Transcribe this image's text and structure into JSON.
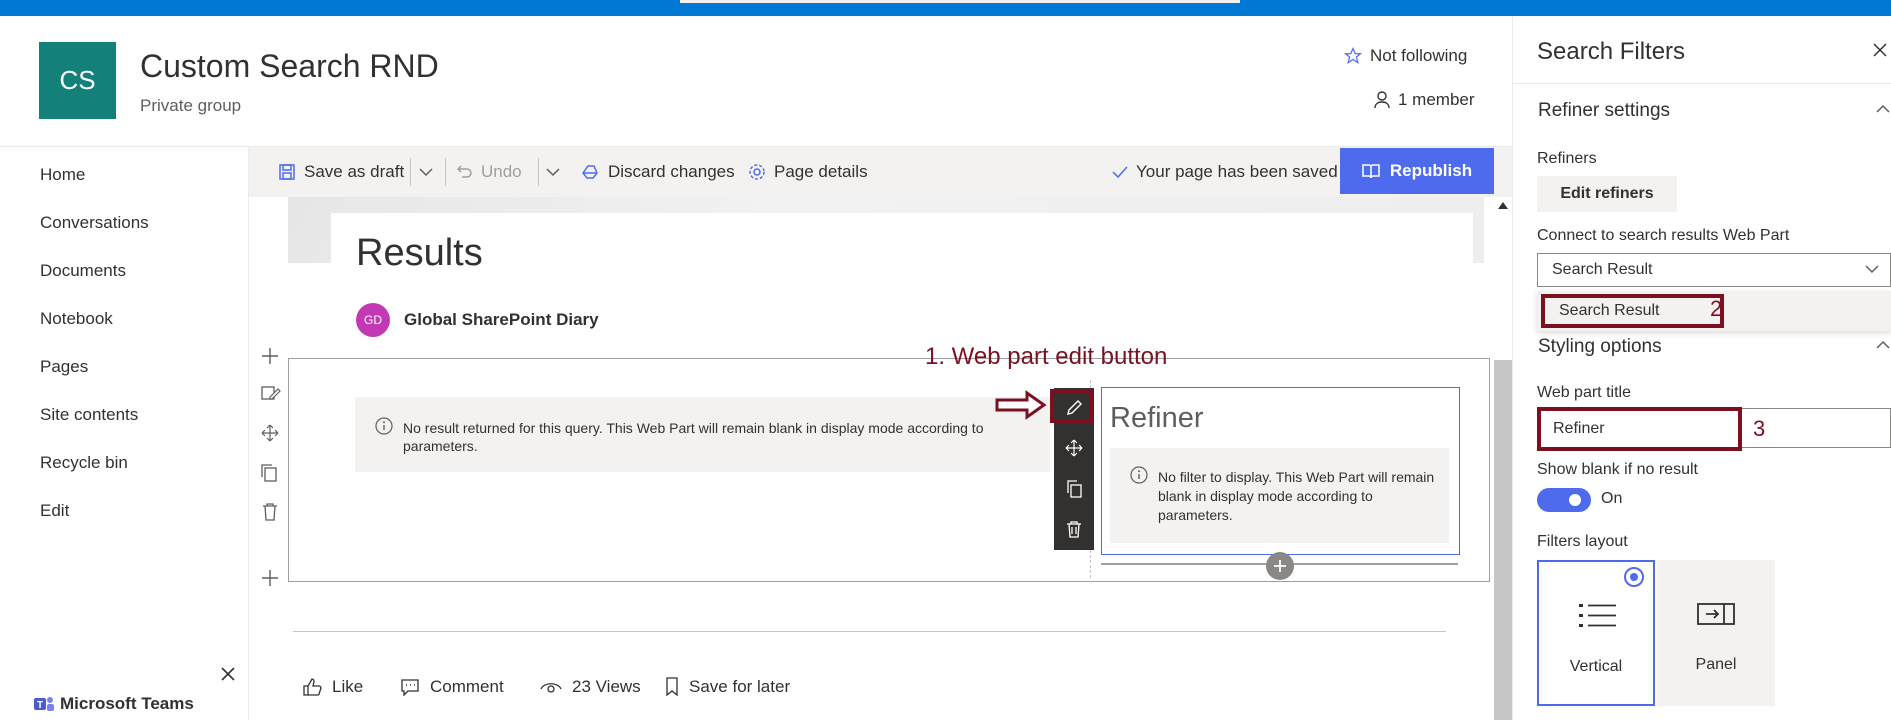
{
  "site": {
    "logo_text": "CS",
    "title": "Custom Search RND",
    "subtitle": "Private group",
    "follow_label": "Not following",
    "members_label": "1 member"
  },
  "nav": {
    "items": [
      "Home",
      "Conversations",
      "Documents",
      "Notebook",
      "Pages",
      "Site contents",
      "Recycle bin",
      "Edit"
    ],
    "teams_label": "Microsoft Teams"
  },
  "commandbar": {
    "save_draft": "Save as draft",
    "undo": "Undo",
    "discard": "Discard changes",
    "page_details": "Page details",
    "saved_status": "Your page has been saved",
    "republish": "Republish"
  },
  "page": {
    "title": "Results",
    "author_initials": "GD",
    "author_name": "Global SharePoint Diary",
    "left_message": "No result returned for this query. This Web Part will remain blank in display mode according to parameters.",
    "refiner_title": "Refiner",
    "right_message": "No filter to display. This Web Part will remain blank in display mode according to parameters."
  },
  "annotations": {
    "edit_button": "1. Web part edit button",
    "num2": "2",
    "num3": "3"
  },
  "footer": {
    "like": "Like",
    "comment": "Comment",
    "views": "23 Views",
    "save_later": "Save for later"
  },
  "panel": {
    "title": "Search Filters",
    "refiner_settings": "Refiner settings",
    "refiners_label": "Refiners",
    "edit_refiners": "Edit refiners",
    "connect_label": "Connect to search results Web Part",
    "connect_value": "Search Result",
    "connect_option": "Search Result",
    "styling_options": "Styling options",
    "webpart_title_label": "Web part title",
    "webpart_title_value": "Refiner",
    "show_blank_label": "Show blank if no result",
    "show_blank_state": "On",
    "filters_layout_label": "Filters layout",
    "layout_vertical": "Vertical",
    "layout_panel": "Panel"
  },
  "colors": {
    "suite_bar": "#0078d4",
    "logo_bg": "#138079",
    "accent": "#4f6bed",
    "annotation": "#7b1021",
    "avatar": "#c239b3"
  }
}
